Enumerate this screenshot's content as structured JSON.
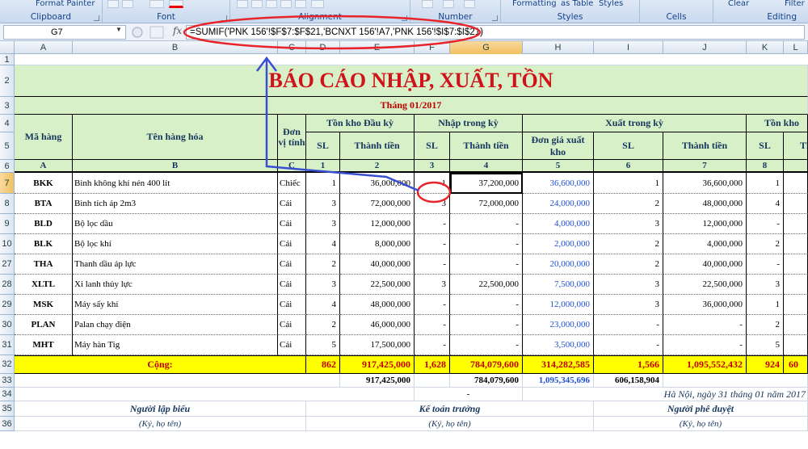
{
  "ribbon": {
    "clipboard_label": "Clipboard",
    "format_painter": "Format Painter",
    "font_label": "Font",
    "alignment_label": "Alignment",
    "number_label": "Number",
    "styles_label": "Styles",
    "formatting_label": "Formatting",
    "as_table_label": "as Table",
    "styles_btn": "Styles",
    "cells_label": "Cells",
    "editing_label": "Editing",
    "clear_label": "Clear",
    "filter_label": "Filter"
  },
  "formula_bar": {
    "name_box": "G7",
    "fx": "fx",
    "formula": "=SUMIF('PNK 156'!$F$7:$F$21,'BCNXT 156'!A7,'PNK 156'!$I$7:$I$21)"
  },
  "columns": [
    "A",
    "B",
    "C",
    "D",
    "E",
    "F",
    "G",
    "H",
    "I",
    "J",
    "K",
    "L"
  ],
  "row_numbers": [
    "1",
    "2",
    "3",
    "4",
    "5",
    "6",
    "7",
    "8",
    "9",
    "10",
    "27",
    "28",
    "29",
    "30",
    "31",
    "32",
    "33",
    "34",
    "35",
    "36"
  ],
  "report": {
    "title": "BÁO CÁO NHẬP, XUẤT, TỒN",
    "subtitle": "Tháng 01/2017",
    "headers": {
      "ma_hang": "Mã hàng",
      "ten_hang": "Tên hàng hóa",
      "dvt": "Đơn vị tính",
      "ton_dau": "Tồn kho Đầu kỳ",
      "nhap": "Nhập trong kỳ",
      "xuat": "Xuất trong kỳ",
      "ton_cuoi": "Tồn kho",
      "sl": "SL",
      "thanh_tien": "Thành tiền",
      "don_gia_xuat": "Đơn giá xuất kho",
      "th_partial": "Th"
    },
    "index_row": [
      "A",
      "B",
      "C",
      "1",
      "2",
      "3",
      "4",
      "5",
      "6",
      "7",
      "8",
      ""
    ],
    "rows": [
      {
        "code": "BKK",
        "name": "Bình không khí nén 400 lít",
        "unit": "Chiếc",
        "sl1": "1",
        "tt1": "36,000,000",
        "sl2": "1",
        "tt2": "37,200,000",
        "dg": "36,600,000",
        "sl3": "1",
        "tt3": "36,600,000",
        "sl4": "1"
      },
      {
        "code": "BTA",
        "name": "Bình tích áp 2m3",
        "unit": "Cái",
        "sl1": "3",
        "tt1": "72,000,000",
        "sl2": "3",
        "tt2": "72,000,000",
        "dg": "24,000,000",
        "sl3": "2",
        "tt3": "48,000,000",
        "sl4": "4"
      },
      {
        "code": "BLD",
        "name": "Bộ lọc dầu",
        "unit": "Cái",
        "sl1": "3",
        "tt1": "12,000,000",
        "sl2": "-",
        "tt2": "-",
        "dg": "4,000,000",
        "sl3": "3",
        "tt3": "12,000,000",
        "sl4": "-"
      },
      {
        "code": "BLK",
        "name": "Bộ lọc khí",
        "unit": "Cái",
        "sl1": "4",
        "tt1": "8,000,000",
        "sl2": "-",
        "tt2": "-",
        "dg": "2,000,000",
        "sl3": "2",
        "tt3": "4,000,000",
        "sl4": "2"
      },
      {
        "code": "THA",
        "name": "Thanh dầu áp lực",
        "unit": "Cái",
        "sl1": "2",
        "tt1": "40,000,000",
        "sl2": "-",
        "tt2": "-",
        "dg": "20,000,000",
        "sl3": "2",
        "tt3": "40,000,000",
        "sl4": "-"
      },
      {
        "code": "XLTL",
        "name": "Xi lanh thủy lực",
        "unit": "Cái",
        "sl1": "3",
        "tt1": "22,500,000",
        "sl2": "3",
        "tt2": "22,500,000",
        "dg": "7,500,000",
        "sl3": "3",
        "tt3": "22,500,000",
        "sl4": "3"
      },
      {
        "code": "MSK",
        "name": "Máy sấy khí",
        "unit": "Cái",
        "sl1": "4",
        "tt1": "48,000,000",
        "sl2": "-",
        "tt2": "-",
        "dg": "12,000,000",
        "sl3": "3",
        "tt3": "36,000,000",
        "sl4": "1"
      },
      {
        "code": "PLAN",
        "name": "Palan chạy điện",
        "unit": "Cái",
        "sl1": "2",
        "tt1": "46,000,000",
        "sl2": "-",
        "tt2": "-",
        "dg": "23,000,000",
        "sl3": "-",
        "tt3": "-",
        "sl4": "2"
      },
      {
        "code": "MHT",
        "name": "Máy hàn Tig",
        "unit": "Cái",
        "sl1": "5",
        "tt1": "17,500,000",
        "sl2": "-",
        "tt2": "-",
        "dg": "3,500,000",
        "sl3": "-",
        "tt3": "-",
        "sl4": "5"
      }
    ],
    "total": {
      "label": "Cộng:",
      "sl1": "862",
      "tt1": "917,425,000",
      "sl2": "1,628",
      "tt2": "784,079,600",
      "dg": "314,282,585",
      "sl3": "1,566",
      "tt3": "1,095,552,432",
      "sl4": "924",
      "l": "60"
    },
    "row33": {
      "e": "917,425,000",
      "g": "784,079,600",
      "h": "1,095,345,696",
      "i": "606,158,904"
    },
    "row34": {
      "f": "-",
      "date": "Hà Nội, ngày 31 tháng 01 năm 2017"
    },
    "signatures": {
      "nguoi_lap": "Người lập biểu",
      "ke_toan": "Kế toán trưởng",
      "nguoi_duyet": "Người phê duyệt",
      "ky_ten": "(Ký, họ tên)"
    }
  },
  "colors": {
    "header_green": "#d7f0c8",
    "total_yellow": "#ffff00",
    "annotation_red": "#e8242b",
    "annotation_blue": "#3a4fd0",
    "title_red": "#d0131a",
    "blue_values": "#1f4fd6"
  }
}
